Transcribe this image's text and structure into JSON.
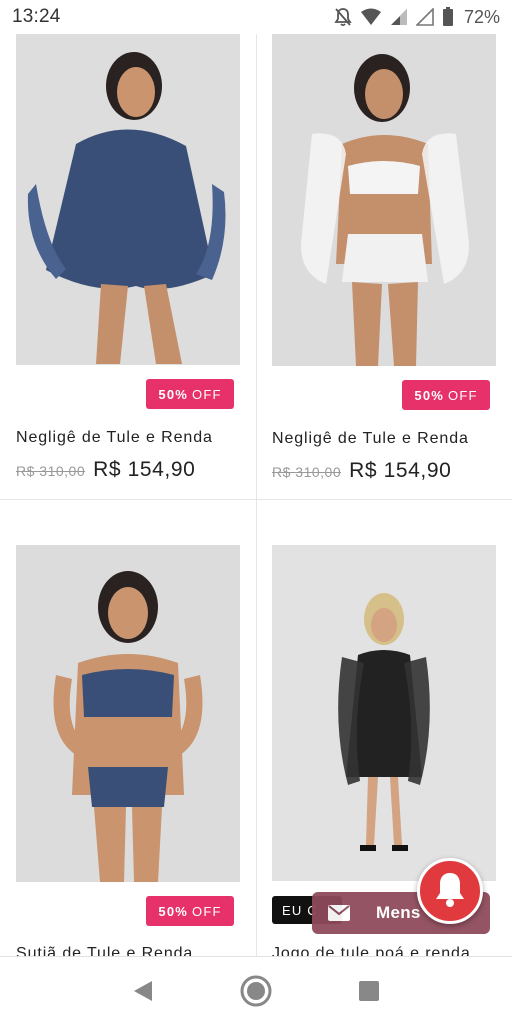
{
  "status_bar": {
    "time": "13:24",
    "battery_percent": "72%",
    "icons": [
      "notifications-off-icon",
      "wifi-icon",
      "signal-icon",
      "signal-icon",
      "battery-icon"
    ]
  },
  "products": [
    {
      "badge_percent": "50%",
      "badge_off": "OFF",
      "title": "Negligê de Tule e Renda",
      "old_price": "R$ 310,00",
      "new_price": "R$ 154,90"
    },
    {
      "badge_percent": "50%",
      "badge_off": "OFF",
      "title": "Negligê de Tule e Renda",
      "old_price": "R$ 310,00",
      "new_price": "R$ 154,90"
    },
    {
      "badge_percent": "50%",
      "badge_off": "OFF",
      "title": "Sutiã de Tule e Renda"
    },
    {
      "badge_label": "EU C",
      "title": "Jogo de tule poá e renda"
    }
  ],
  "chat_widget": {
    "label": "Mens"
  },
  "colors": {
    "badge": "#e6316a",
    "chat_bar": "#8e4a5a",
    "bell": "#e0393e"
  },
  "nav": {
    "icons": [
      "back-icon",
      "home-icon",
      "recents-icon"
    ]
  }
}
